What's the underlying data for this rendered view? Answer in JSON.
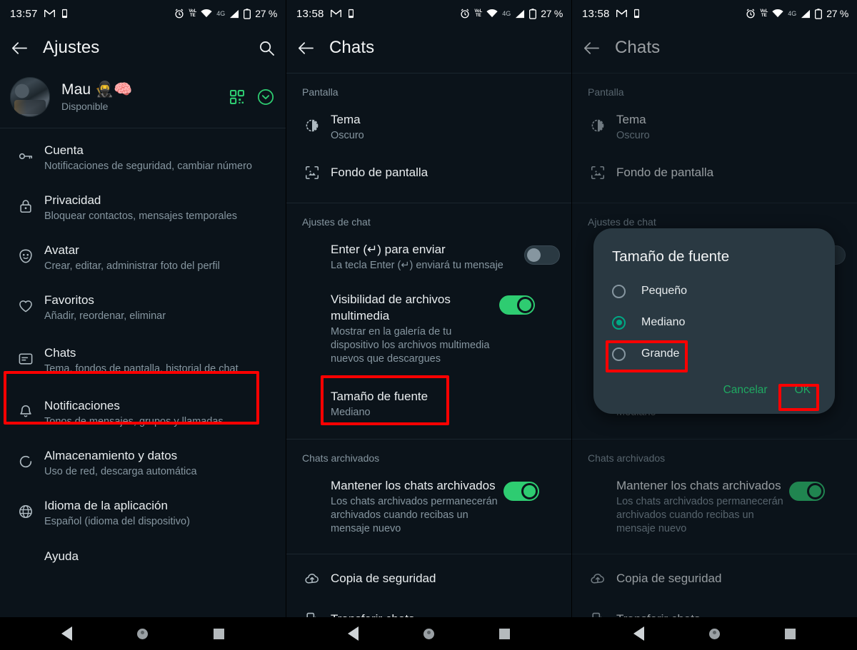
{
  "status_bar": {
    "time_panel1": "13:57",
    "time_panel2": "13:58",
    "time_panel3": "13:58",
    "network_label": "VoLTE",
    "data_label": "4G",
    "battery": "27 %",
    "icons": [
      "gmail-icon",
      "vibrate-icon",
      "alarm-icon",
      "volte-icon",
      "wifi-icon",
      "signal-icon",
      "battery-icon"
    ]
  },
  "panel1": {
    "appbar": {
      "title": "Ajustes",
      "back_icon": "back-arrow-icon",
      "search_icon": "search-icon"
    },
    "profile": {
      "name": "Mau 🥷🧠",
      "status": "Disponible",
      "qr_icon": "qr-code-icon",
      "expand_icon": "chevron-down-circle-icon"
    },
    "items": [
      {
        "icon": "key-icon",
        "title": "Cuenta",
        "subtitle": "Notificaciones de seguridad, cambiar número"
      },
      {
        "icon": "lock-icon",
        "title": "Privacidad",
        "subtitle": "Bloquear contactos, mensajes temporales"
      },
      {
        "icon": "avatar-icon",
        "title": "Avatar",
        "subtitle": "Crear, editar, administrar foto del perfil"
      },
      {
        "icon": "heart-icon",
        "title": "Favoritos",
        "subtitle": "Añadir, reordenar, eliminar"
      },
      {
        "icon": "chat-icon",
        "title": "Chats",
        "subtitle": "Tema, fondos de pantalla, historial de chat",
        "highlighted": true
      },
      {
        "icon": "bell-icon",
        "title": "Notificaciones",
        "subtitle": "Tonos de mensajes, grupos y llamadas"
      },
      {
        "icon": "storage-icon",
        "title": "Almacenamiento y datos",
        "subtitle": "Uso de red, descarga automática"
      },
      {
        "icon": "globe-icon",
        "title": "Idioma de la aplicación",
        "subtitle": "Español (idioma del dispositivo)"
      },
      {
        "icon": "help-icon",
        "title": "Ayuda",
        "subtitle": ""
      }
    ]
  },
  "panel2": {
    "appbar": {
      "title": "Chats",
      "back_icon": "back-arrow-icon"
    },
    "sections": [
      {
        "header": "Pantalla",
        "rows": [
          {
            "icon": "theme-icon",
            "title": "Tema",
            "subtitle": "Oscuro"
          },
          {
            "icon": "wallpaper-icon",
            "title": "Fondo de pantalla",
            "subtitle": ""
          }
        ]
      },
      {
        "header": "Ajustes de chat",
        "rows": [
          {
            "icon": "",
            "title": "Enter (↵) para enviar",
            "subtitle": "La tecla Enter (↵) enviará tu mensaje",
            "toggle": "off"
          },
          {
            "icon": "",
            "title": "Visibilidad de archivos multimedia",
            "subtitle": "Mostrar en la galería de tu dispositivo los archivos multimedia nuevos que descargues",
            "toggle": "on"
          },
          {
            "icon": "",
            "title": "Tamaño de fuente",
            "subtitle": "Mediano",
            "highlighted": true
          }
        ]
      },
      {
        "header": "Chats archivados",
        "rows": [
          {
            "icon": "",
            "title": "Mantener los chats archivados",
            "subtitle": "Los chats archivados permanecerán archivados cuando recibas un mensaje nuevo",
            "toggle": "on"
          }
        ]
      },
      {
        "header": "",
        "rows": [
          {
            "icon": "backup-icon",
            "title": "Copia de seguridad",
            "subtitle": ""
          },
          {
            "icon": "transfer-icon",
            "title": "Transferir chats",
            "subtitle": ""
          }
        ]
      }
    ]
  },
  "panel3": {
    "appbar": {
      "title": "Chats",
      "back_icon": "back-arrow-icon"
    },
    "dialog": {
      "title": "Tamaño de fuente",
      "options": [
        {
          "label": "Pequeño",
          "selected": false
        },
        {
          "label": "Mediano",
          "selected": true
        },
        {
          "label": "Grande",
          "selected": false,
          "highlighted": true
        }
      ],
      "cancel_label": "Cancelar",
      "ok_label": "OK",
      "ok_highlighted": true
    }
  },
  "navbar": {
    "back_label": "back-nav-button",
    "home_label": "home-nav-button",
    "recents_label": "recents-nav-button"
  },
  "colors": {
    "background": "#0b131a",
    "accent_green": "#2ecc71",
    "link_green": "#1faa62",
    "highlight_red": "#ff0000",
    "dialog_bg": "#2a3942",
    "primary_text": "#e9edef",
    "secondary_text": "#8696a0"
  }
}
